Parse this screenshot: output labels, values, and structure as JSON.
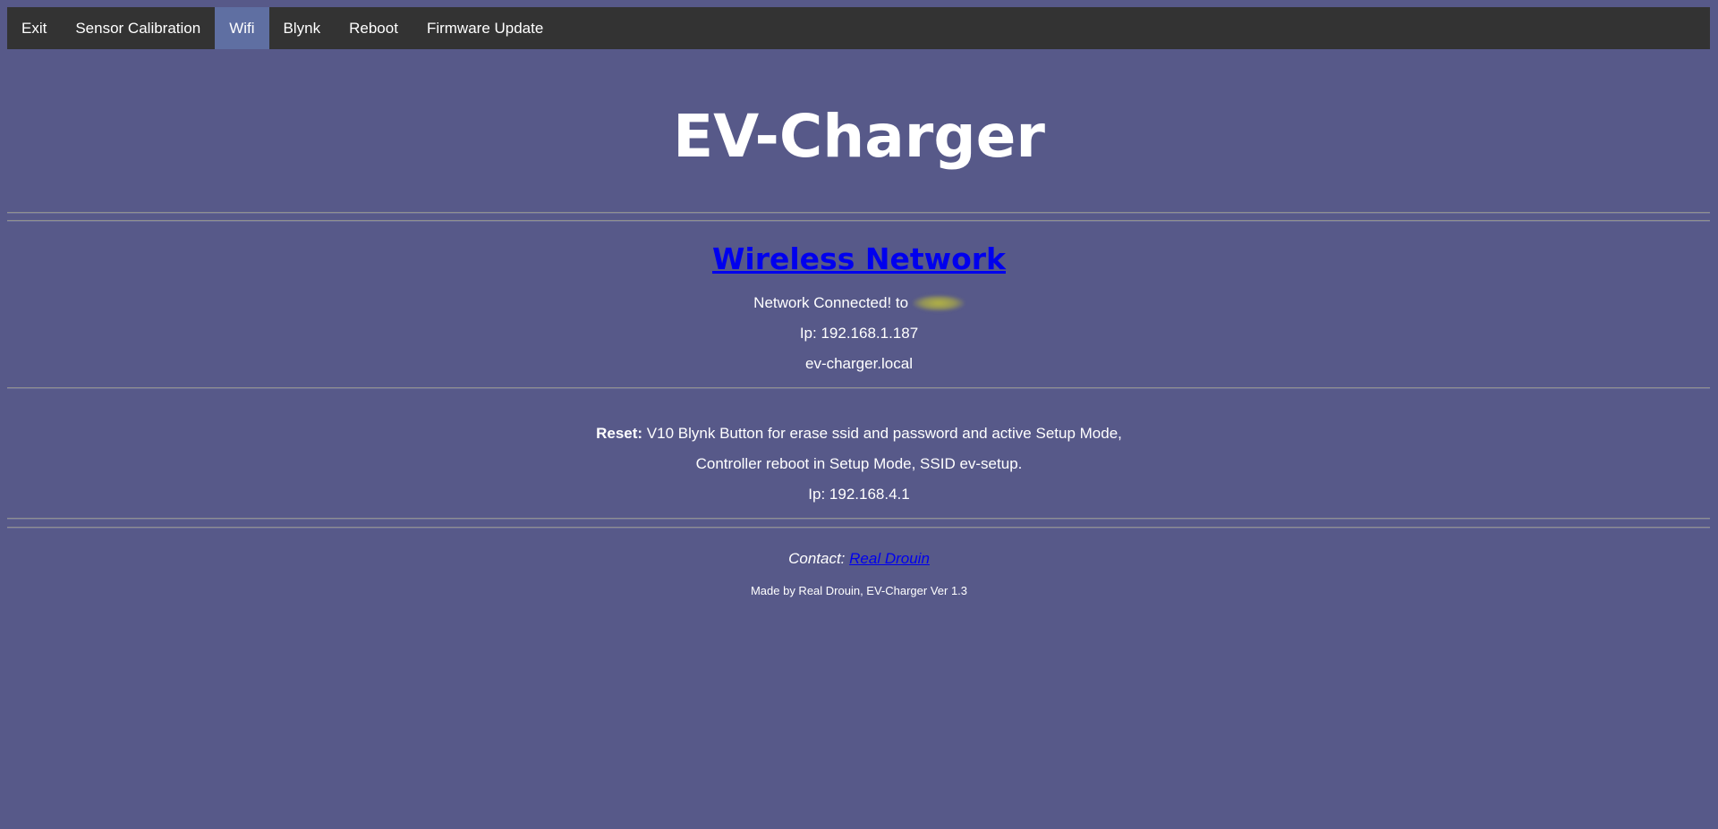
{
  "nav": {
    "items": [
      {
        "label": "Exit"
      },
      {
        "label": "Sensor Calibration"
      },
      {
        "label": "Wifi"
      },
      {
        "label": "Blynk"
      },
      {
        "label": "Reboot"
      },
      {
        "label": "Firmware Update"
      }
    ],
    "active": "Wifi",
    "active_color": "#5f6fa2",
    "bar_color": "#333333"
  },
  "page": {
    "title": "EV-Charger",
    "background": "#575989"
  },
  "wifi": {
    "heading": "Wireless Network",
    "connected_text": "Network Connected! to",
    "ip_text": "Ip: 192.168.1.187",
    "hostname": "ev-charger.local"
  },
  "reset": {
    "label": "Reset:",
    "line1": " V10 Blynk Button for erase ssid and password and active Setup Mode,",
    "line2": "Controller reboot in Setup Mode, SSID ev-setup.",
    "ip_text": "Ip: 192.168.4.1"
  },
  "footer": {
    "contact_label": "Contact: ",
    "contact_link": "Real Drouin",
    "made_by": "Made by Real Drouin, EV-Charger Ver 1.3"
  }
}
